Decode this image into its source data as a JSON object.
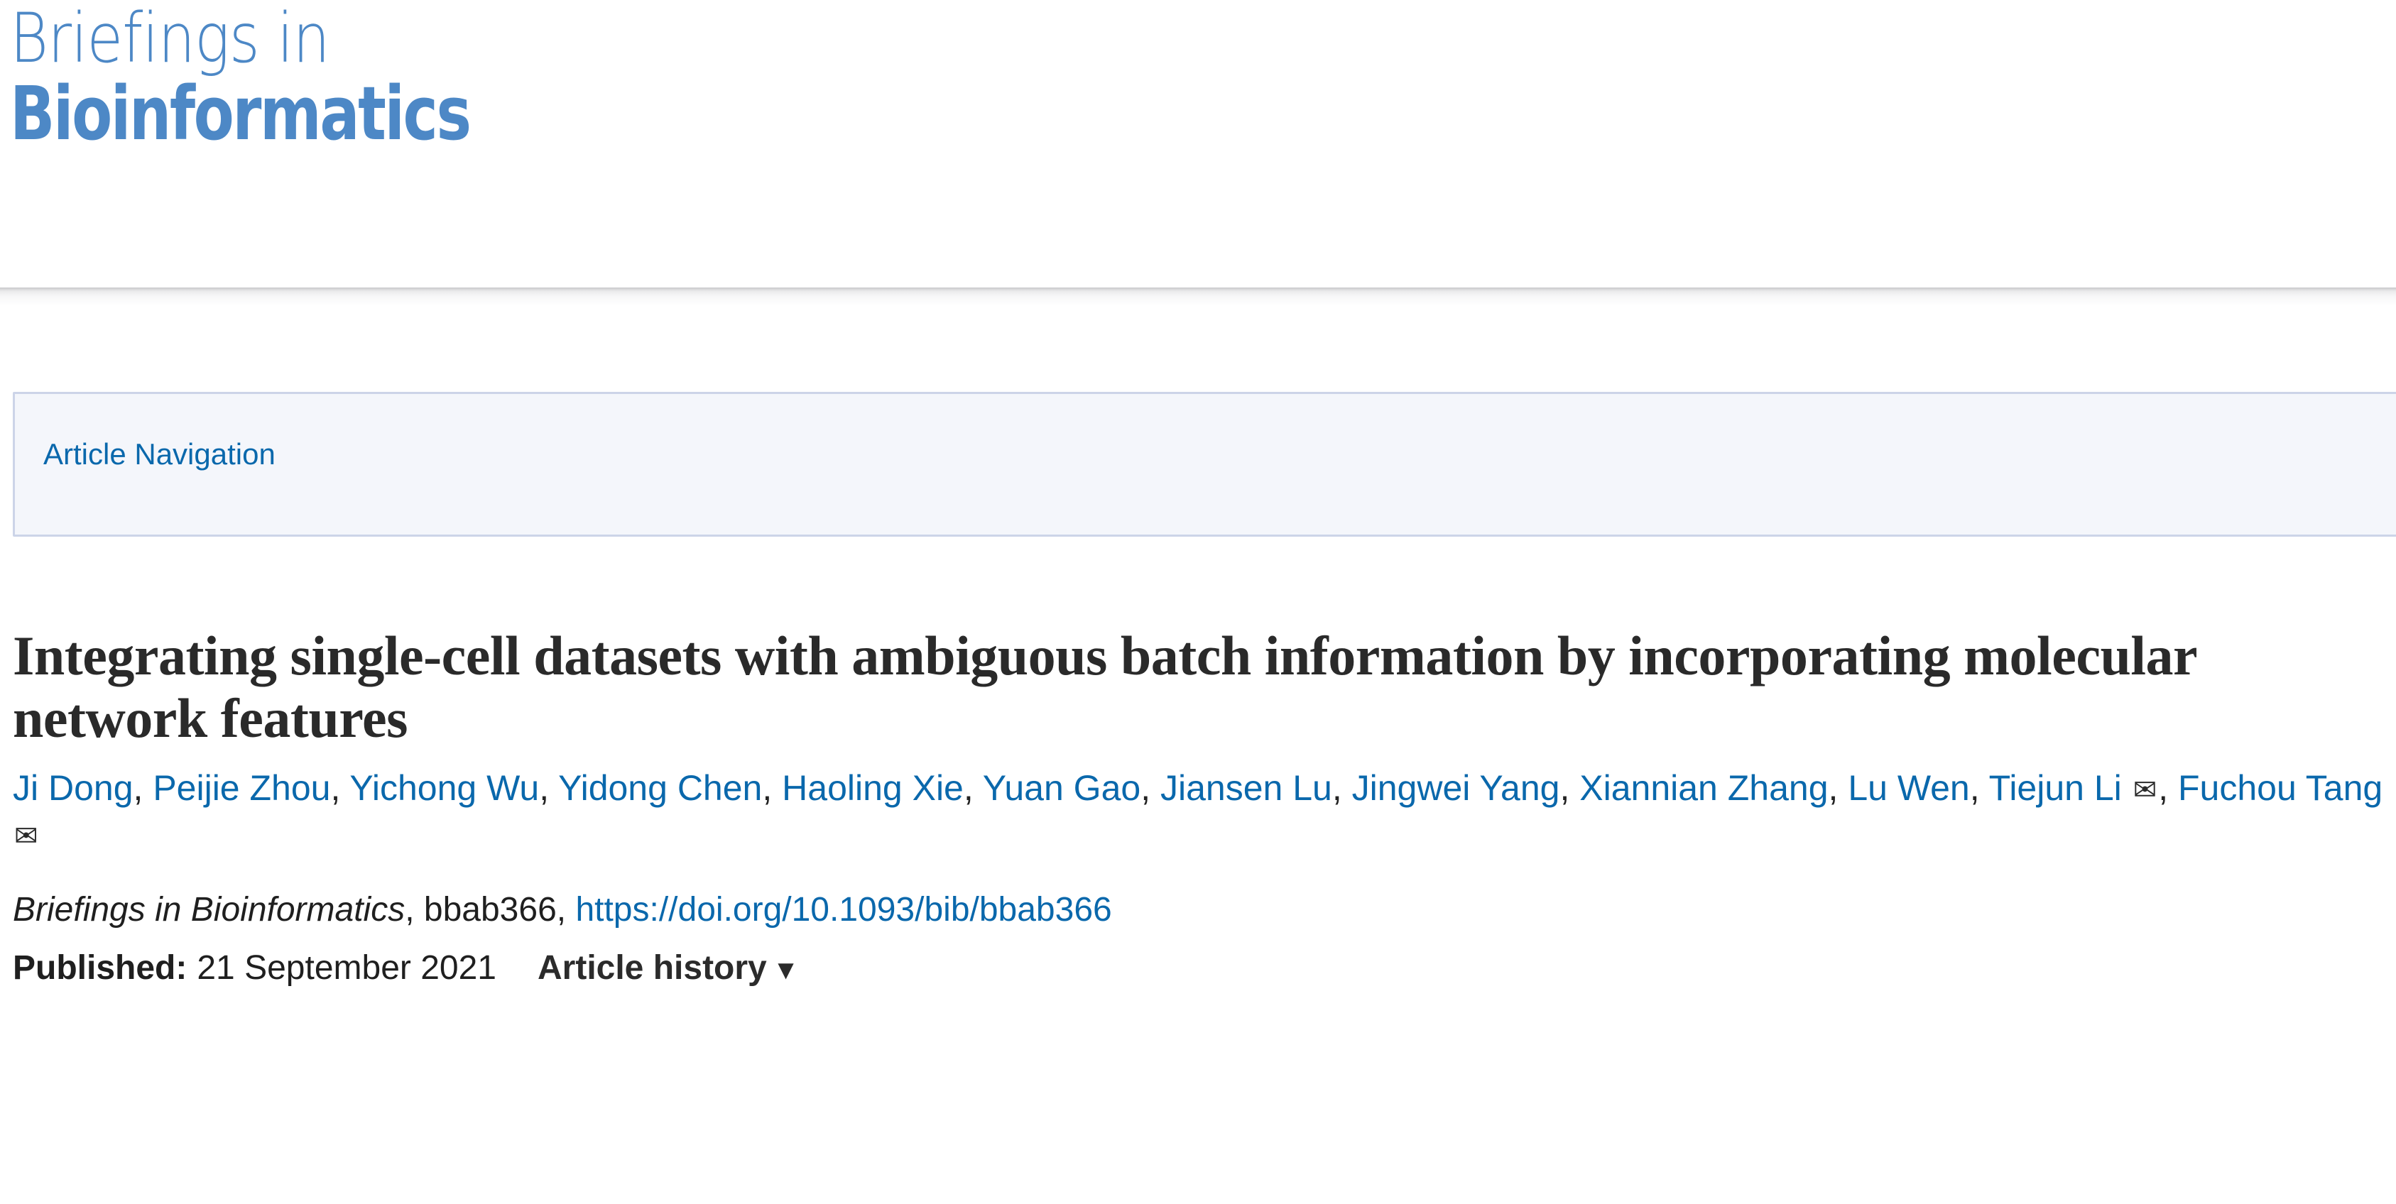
{
  "masthead": {
    "logo_line1": "Briefings in",
    "logo_line2": "Bioinformatics",
    "logo_color": "#4d88c6"
  },
  "article_nav": {
    "label": "Article Navigation",
    "background": "#f4f6fb",
    "border_color": "#ccd4e8",
    "link_color": "#0a68ac"
  },
  "article": {
    "title": "Integrating single-cell datasets with ambiguous batch information by incorporating molecular network features",
    "authors": [
      {
        "name": "Ji Dong",
        "corresponding": false
      },
      {
        "name": "Peijie Zhou",
        "corresponding": false
      },
      {
        "name": "Yichong Wu",
        "corresponding": false
      },
      {
        "name": "Yidong Chen",
        "corresponding": false
      },
      {
        "name": "Haoling Xie",
        "corresponding": false
      },
      {
        "name": "Yuan Gao",
        "corresponding": false
      },
      {
        "name": "Jiansen Lu",
        "corresponding": false
      },
      {
        "name": "Jingwei Yang",
        "corresponding": false
      },
      {
        "name": "Xiannian Zhang",
        "corresponding": false
      },
      {
        "name": "Lu Wen",
        "corresponding": false
      },
      {
        "name": "Tiejun Li",
        "corresponding": true
      },
      {
        "name": "Fuchou Tang",
        "corresponding": true
      }
    ],
    "author_separator": ", ",
    "envelope_icon": "✉",
    "citation": {
      "journal": "Briefings in Bioinformatics",
      "separator1": ", ",
      "article_id": "bbab366",
      "separator2": ", ",
      "doi_text": "https://doi.org/10.1093/bib/bbab366"
    },
    "published": {
      "label": "Published:",
      "date": "21 September 2021",
      "history_label": "Article history",
      "caret": "▼"
    },
    "title_color": "#2a2a2a",
    "link_color": "#0a68ac"
  }
}
